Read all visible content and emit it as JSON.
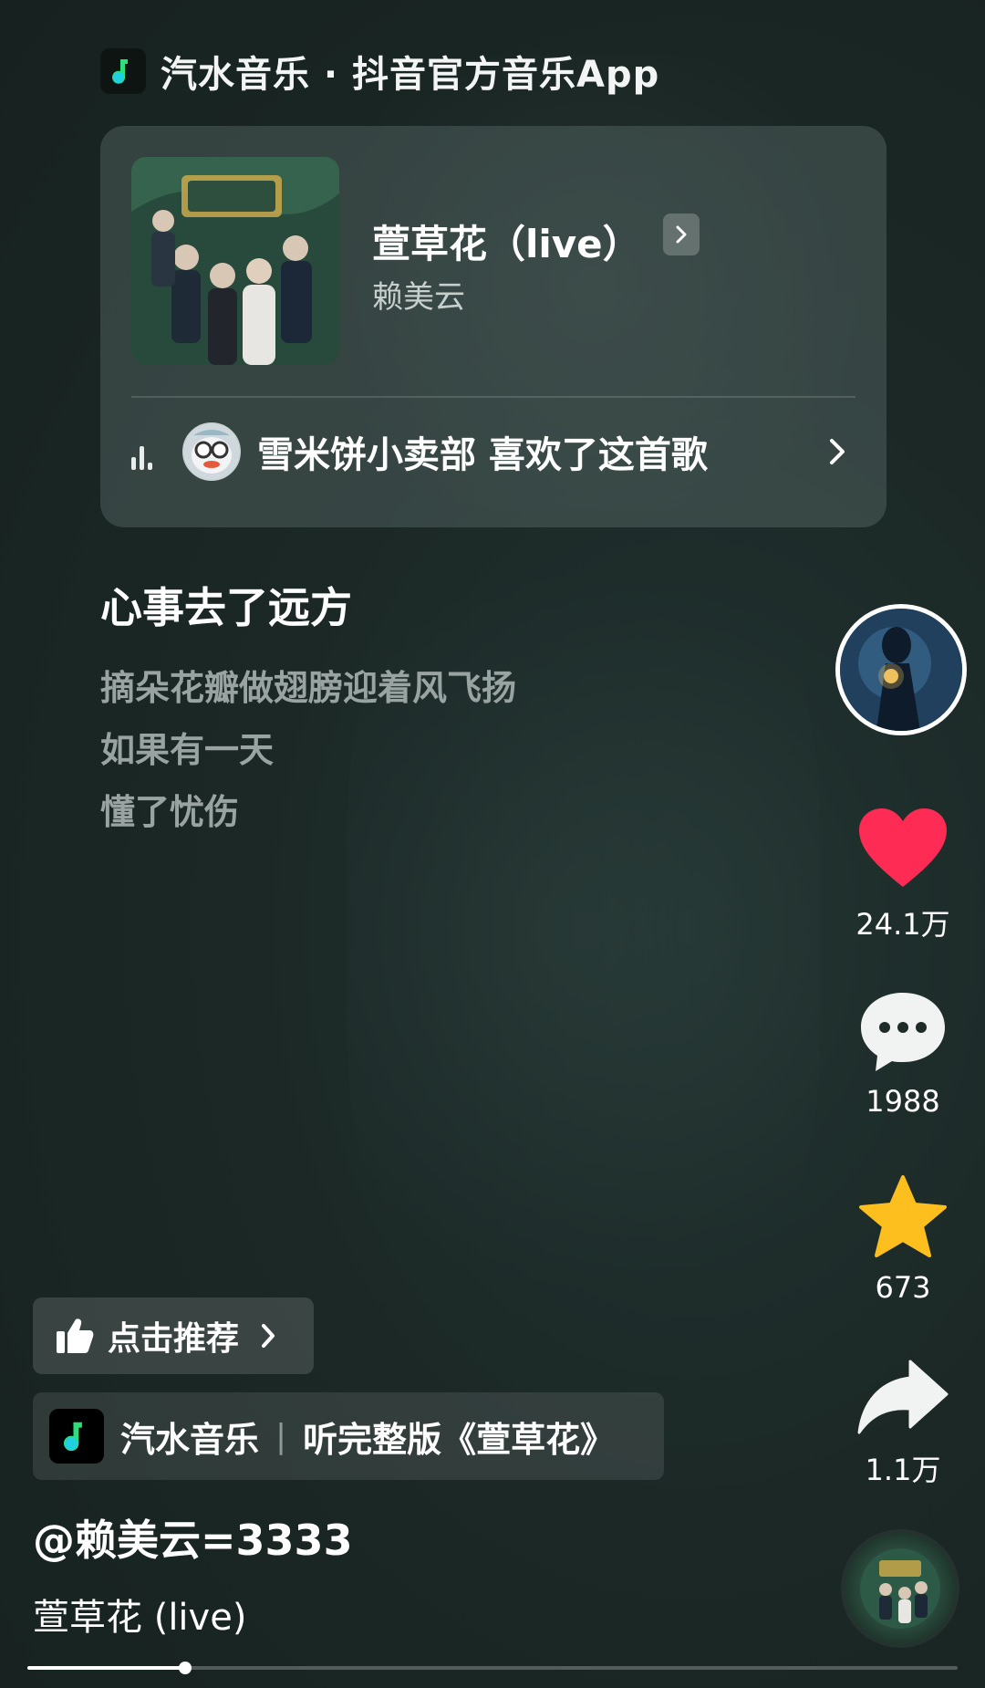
{
  "brand": {
    "logo": "qishui-music-logo",
    "text": "汽水音乐 · 抖音官方音乐App"
  },
  "song_card": {
    "title": "萱草花（live）",
    "artist": "赖美云",
    "cover": "album-cover",
    "liked_by_text": "雪米饼小卖部 喜欢了这首歌"
  },
  "lyrics": {
    "current": "心事去了远方",
    "upcoming": [
      "摘朵花瓣做翅膀迎着风飞扬",
      "如果有一天",
      "懂了忧伤"
    ]
  },
  "actions": {
    "likes": "24.1万",
    "comments": "1988",
    "favorites": "673",
    "shares": "1.1万"
  },
  "colors": {
    "heart": "#fe2c55",
    "star": "#fcbf1e",
    "accent_green": "#22d16b"
  },
  "bottom": {
    "recommend_label": "点击推荐",
    "promo_app": "汽水音乐",
    "promo_text": "听完整版《萱草花》",
    "author": "@赖美云=3333",
    "description": "萱草花 (live)"
  },
  "playback": {
    "progress": 0.17
  }
}
